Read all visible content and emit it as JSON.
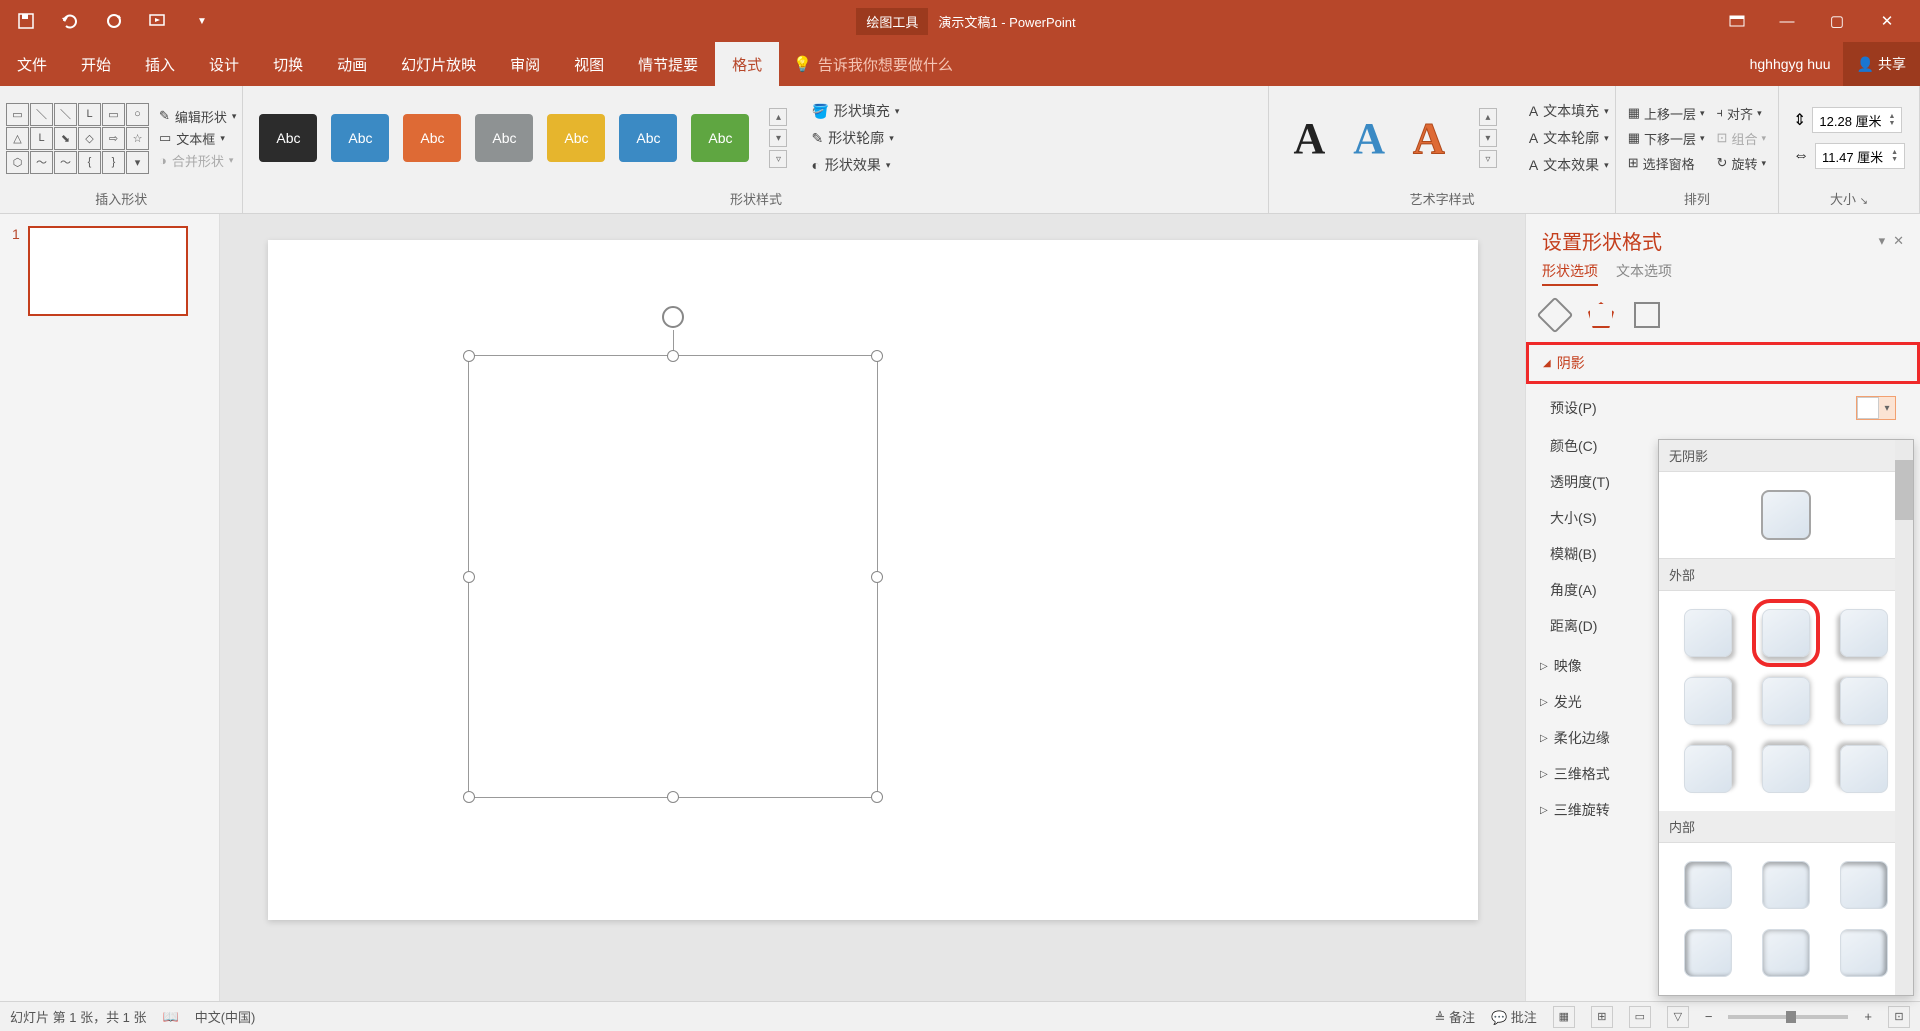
{
  "titlebar": {
    "tool_context": "绘图工具",
    "doc_title": "演示文稿1 - PowerPoint"
  },
  "tabs": {
    "file": "文件",
    "home": "开始",
    "insert": "插入",
    "design": "设计",
    "transitions": "切换",
    "animations": "动画",
    "slideshow": "幻灯片放映",
    "review": "审阅",
    "view": "视图",
    "story": "情节提要",
    "format": "格式",
    "tellme": "告诉我你想要做什么",
    "user": "hghhgyg huu",
    "share": "共享"
  },
  "ribbon": {
    "insert_shapes": {
      "label": "插入形状",
      "edit_shape": "编辑形状",
      "text_box": "文本框",
      "merge_shapes": "合并形状"
    },
    "shape_styles": {
      "label": "形状样式",
      "swatch_text": "Abc",
      "swatches": [
        "#2C2C2C",
        "#3B8AC4",
        "#DE6A35",
        "#8E9293",
        "#E6B52D",
        "#3B8AC4",
        "#5FA641"
      ],
      "fill": "形状填充",
      "outline": "形状轮廓",
      "effects": "形状效果"
    },
    "wordart": {
      "label": "艺术字样式",
      "fill": "文本填充",
      "outline": "文本轮廓",
      "effects": "文本效果"
    },
    "arrange": {
      "label": "排列",
      "bring_forward": "上移一层",
      "send_backward": "下移一层",
      "selection_pane": "选择窗格",
      "align": "对齐",
      "group": "组合",
      "rotate": "旋转"
    },
    "size": {
      "label": "大小",
      "height": "12.28 厘米",
      "width": "11.47 厘米"
    }
  },
  "thumb": {
    "num": "1"
  },
  "pane": {
    "title": "设置形状格式",
    "tab_shape": "形状选项",
    "tab_text": "文本选项",
    "sections": {
      "shadow": "阴影",
      "reflection": "映像",
      "glow": "发光",
      "soft_edges": "柔化边缘",
      "format3d": "三维格式",
      "rotation3d": "三维旋转"
    },
    "shadow_props": {
      "preset": "预设(P)",
      "color": "颜色(C)",
      "transparency": "透明度(T)",
      "size": "大小(S)",
      "blur": "模糊(B)",
      "angle": "角度(A)",
      "distance": "距离(D)"
    },
    "gallery": {
      "no_shadow": "无阴影",
      "outer": "外部",
      "inner": "内部"
    }
  },
  "status": {
    "slide_info": "幻灯片 第 1 张，共 1 张",
    "language": "中文(中国)",
    "notes": "备注",
    "comments": "批注"
  }
}
